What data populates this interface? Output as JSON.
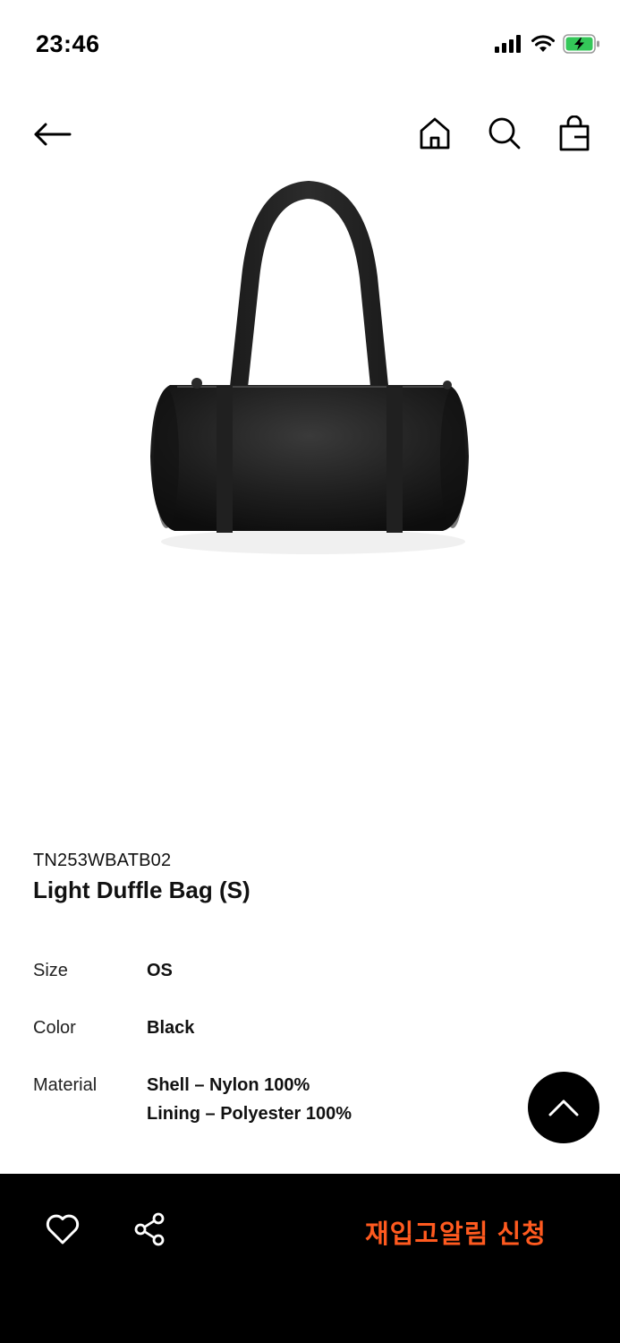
{
  "status_bar": {
    "time": "23:46",
    "icons": [
      "signal-icon",
      "wifi-icon",
      "battery-charging-icon"
    ],
    "battery_color": "#34c759"
  },
  "nav": {
    "icons": [
      "back-arrow-icon",
      "home-icon",
      "search-icon",
      "shopping-bag-icon"
    ]
  },
  "product": {
    "code": "TN253WBATB02",
    "name": "Light Duffle Bag (S)",
    "specs": [
      {
        "label": "Size",
        "value": [
          "OS"
        ]
      },
      {
        "label": "Color",
        "value": [
          "Black"
        ]
      },
      {
        "label": "Material",
        "value": [
          "Shell – Nylon 100%",
          "Lining – Polyester 100%"
        ]
      }
    ]
  },
  "bottom_bar": {
    "cta_label": "재입고알림 신청",
    "cta_color": "#ff5a1f",
    "icons": [
      "heart-icon",
      "share-icon"
    ]
  },
  "floating": {
    "icon": "chevron-up-icon"
  }
}
